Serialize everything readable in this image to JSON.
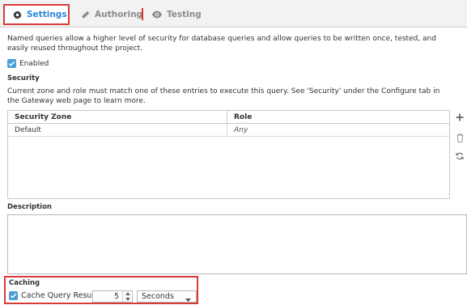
{
  "tabs": [
    {
      "label": "Settings",
      "icon": "gear-icon",
      "active": true
    },
    {
      "label": "Authoring",
      "icon": "pencil-icon",
      "active": false
    },
    {
      "label": "Testing",
      "icon": "eye-icon",
      "active": false
    }
  ],
  "intro_text": "Named queries allow a higher level of security for database queries and allow queries to be written once, tested, and easily reused throughout the project.",
  "enabled": {
    "label": "Enabled",
    "checked": true
  },
  "security": {
    "title": "Security",
    "description": "Current zone and role must match one of these entries to execute this query. See 'Security' under the Configure tab in the Gateway web page to learn more.",
    "columns": [
      "Security Zone",
      "Role"
    ],
    "rows": [
      {
        "zone": "Default",
        "role": "Any"
      }
    ],
    "tools": [
      "plus-icon",
      "trash-icon",
      "refresh-icon"
    ]
  },
  "description": {
    "title": "Description",
    "value": ""
  },
  "caching": {
    "title": "Caching",
    "checkbox_label": "Cache Query Results",
    "checked": true,
    "amount": "5",
    "unit": "Seconds"
  },
  "colors": {
    "accent": "#2b88d8",
    "highlight": "#d93b3b",
    "checkbox": "#4a9fd8"
  }
}
